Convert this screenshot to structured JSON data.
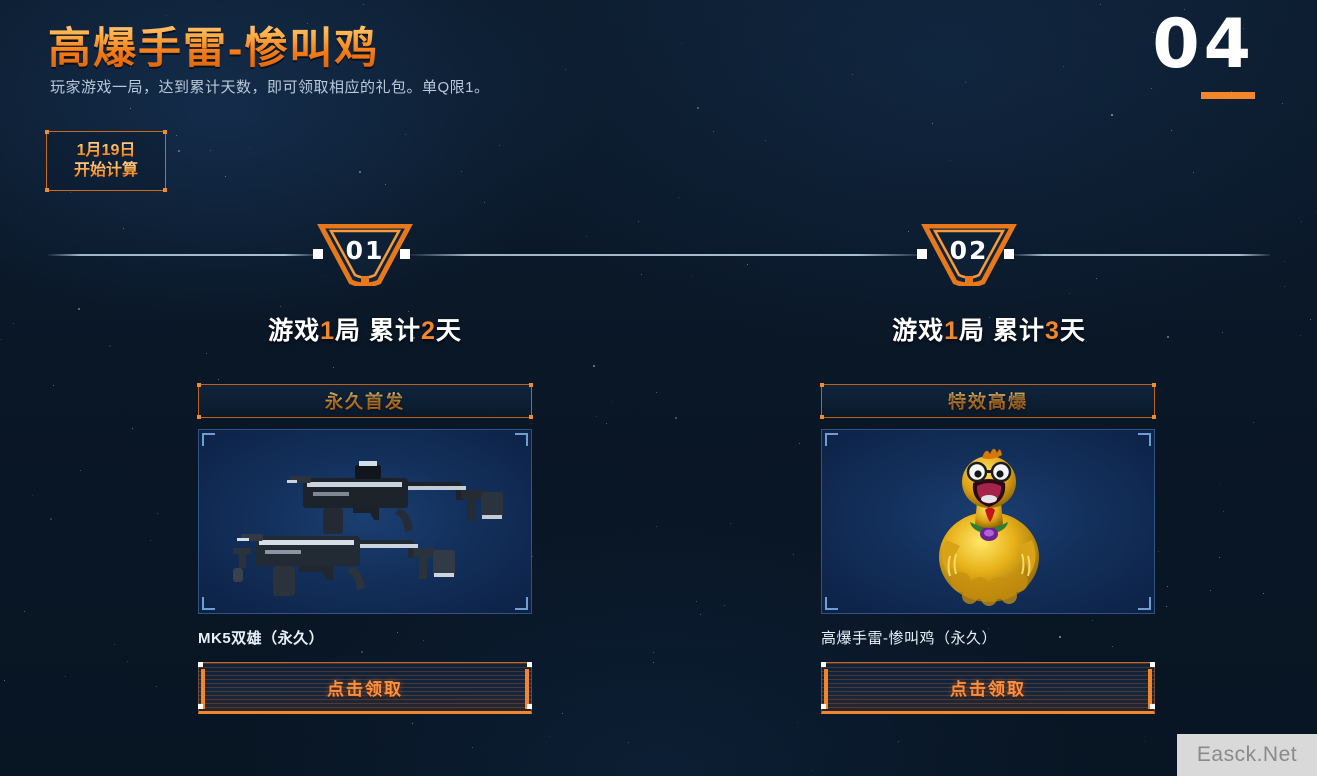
{
  "page": {
    "index_number": "04",
    "title": "高爆手雷-惨叫鸡",
    "subtitle": "玩家游戏一局，达到累计天数，即可领取相应的礼包。单Q限1。",
    "accent_color": "#f2862b",
    "background_color": "#0a1624",
    "text_color": "#e9f1f8"
  },
  "date_badge": {
    "line1": "1月19日",
    "line2": "开始计算"
  },
  "steps": [
    {
      "badge": "01",
      "condition_prefix": "游戏",
      "condition_num1": "1",
      "condition_mid": "局  累计",
      "condition_num2": "2",
      "condition_suffix": "天",
      "condition_full": "游戏1局 累计2天",
      "card": {
        "header": "永久首发",
        "image_icon": "smg-weapon-icon",
        "item_name": "MK5双雄（永久）",
        "claim_label": "点击领取"
      }
    },
    {
      "badge": "02",
      "condition_prefix": "游戏",
      "condition_num1": "1",
      "condition_mid": "局  累计",
      "condition_num2": "3",
      "condition_suffix": "天",
      "condition_full": "游戏1局 累计3天",
      "card": {
        "header": "特效高爆",
        "image_icon": "screaming-chicken-grenade-icon",
        "item_name": "高爆手雷-惨叫鸡（永久）",
        "claim_label": "点击领取"
      }
    }
  ],
  "watermark": {
    "text": "Easck.Net"
  }
}
